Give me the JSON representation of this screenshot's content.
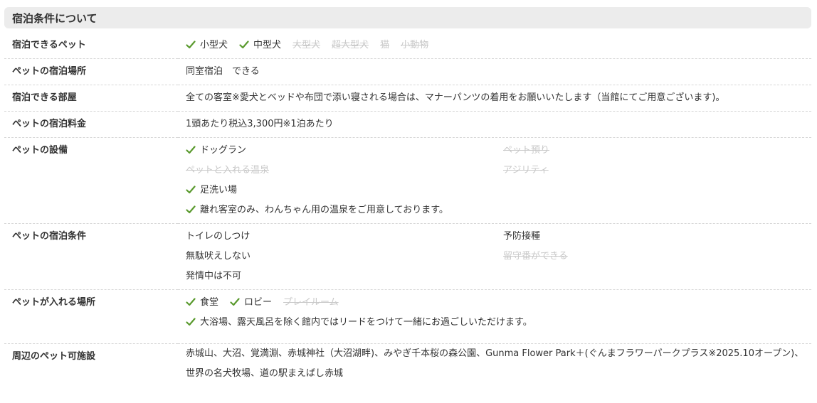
{
  "section": {
    "title": "宿泊条件について"
  },
  "rows": {
    "pet_types": {
      "label": "宿泊できるペット",
      "items": [
        {
          "text": "小型犬",
          "available": true
        },
        {
          "text": "中型犬",
          "available": true
        },
        {
          "text": "大型犬",
          "available": false
        },
        {
          "text": "超大型犬",
          "available": false
        },
        {
          "text": "猫",
          "available": false
        },
        {
          "text": "小動物",
          "available": false
        }
      ]
    },
    "stay_place": {
      "label": "ペットの宿泊場所",
      "value": "同室宿泊　できる"
    },
    "rooms": {
      "label": "宿泊できる部屋",
      "value": "全ての客室※愛犬とベッドや布団で添い寝される場合は、マナーパンツの着用をお願いいたします（当館にてご用意ございます)。"
    },
    "fee": {
      "label": "ペットの宿泊料金",
      "value": "1頭あたり税込3,300円※1泊あたり"
    },
    "facilities": {
      "label": "ペットの設備",
      "items": [
        {
          "text": "ドッグラン",
          "available": true
        },
        {
          "text": "ペット預り",
          "available": false
        },
        {
          "text": "ペットと入れる温泉",
          "available": false
        },
        {
          "text": "アジリティ",
          "available": false
        },
        {
          "text": "足洗い場",
          "available": true
        },
        {
          "text": "離れ客室のみ、わんちゃん用の温泉をご用意しております。",
          "available": true
        }
      ]
    },
    "conditions": {
      "label": "ペットの宿泊条件",
      "items": [
        {
          "text": "トイレのしつけ",
          "available": true
        },
        {
          "text": "予防接種",
          "available": true
        },
        {
          "text": "無駄吠えしない",
          "available": true
        },
        {
          "text": "留守番ができる",
          "available": false
        },
        {
          "text": "発情中は不可",
          "available": true
        }
      ]
    },
    "allowed_areas": {
      "label": "ペットが入れる場所",
      "items": [
        {
          "text": "食堂",
          "available": true
        },
        {
          "text": "ロビー",
          "available": true
        },
        {
          "text": "プレイルーム",
          "available": false
        }
      ],
      "note": "大浴場、露天風呂を除く館内ではリードをつけて一緒にお過ごしいただけます。"
    },
    "nearby": {
      "label": "周辺のペット可施設",
      "value": "赤城山、大沼、覚満淵、赤城神社（大沼湖畔)、みやぎ千本桜の森公園、Gunma Flower Park＋(ぐんまフラワーパークプラス※2025.10オープン)、世界の名犬牧場、道の駅まえばし赤城"
    }
  },
  "colors": {
    "check": "#5a9a2e",
    "disabled": "#c9c9c9",
    "header_bg": "#ececec",
    "text": "#333333"
  }
}
